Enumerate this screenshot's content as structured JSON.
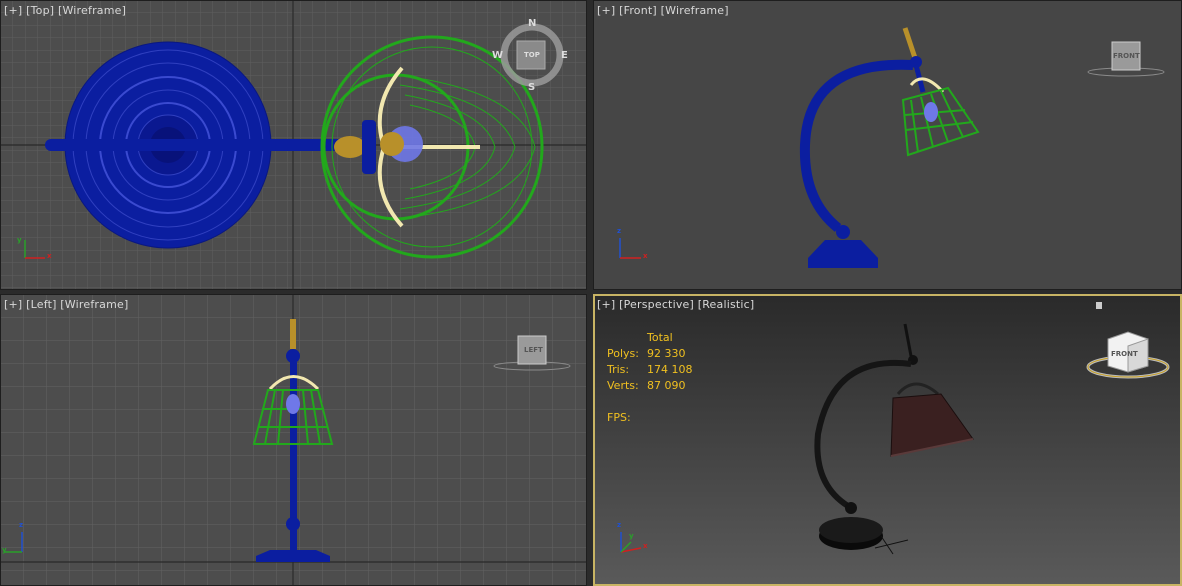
{
  "viewports": {
    "top": {
      "plus": "[+]",
      "view": "[Top]",
      "shading": "[Wireframe]",
      "cube": "TOP",
      "compass": {
        "n": "N",
        "s": "S",
        "e": "E",
        "w": "W"
      }
    },
    "front": {
      "plus": "[+]",
      "view": "[Front]",
      "shading": "[Wireframe]",
      "cube": "FRONT"
    },
    "left": {
      "plus": "[+]",
      "view": "[Left]",
      "shading": "[Wireframe]",
      "cube": "LEFT"
    },
    "persp": {
      "plus": "[+]",
      "view": "[Perspective]",
      "shading": "[Realistic]",
      "cube": "FRONT"
    }
  },
  "stats": {
    "header": "Total",
    "rows": [
      {
        "label": "Polys:",
        "value": "92 330"
      },
      {
        "label": "Tris:",
        "value": "174 108"
      },
      {
        "label": "Verts:",
        "value": "87 090"
      }
    ],
    "fps_label": "FPS:"
  },
  "axes": {
    "x": "x",
    "y": "y",
    "z": "z"
  },
  "colors": {
    "viewport_bg": "#4d4d4d",
    "grid": "#5e5e5e",
    "grid_main": "#2e2e2e",
    "lamp_blue": "#0b1ea0",
    "shade_green": "#22a81c",
    "brass": "#b8902a",
    "cream": "#f2e8b0",
    "active_border": "#c8b464",
    "stats_text": "#f0c020"
  }
}
